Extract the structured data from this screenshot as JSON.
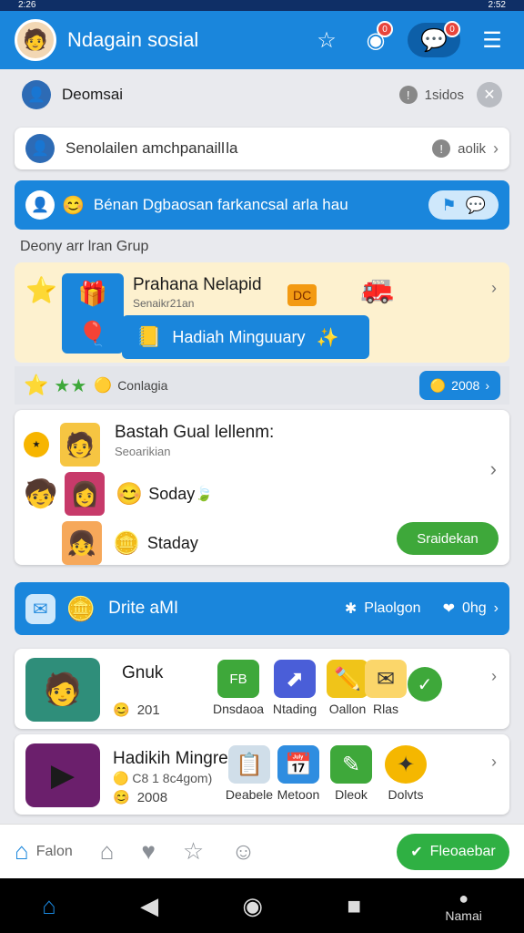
{
  "status": {
    "time": "2:26",
    "battery": "2:52"
  },
  "header": {
    "title": "Ndagain sosial",
    "badge_games": "0",
    "badge_chat": "0"
  },
  "notice": {
    "text": "Deomsai",
    "meta": "1sidos"
  },
  "search": {
    "text": "Senolailen amchpanaill la",
    "meta": "aolik"
  },
  "banner": {
    "text": "Bénan Dgbaosan farkancsal arla hau"
  },
  "section_label": "Deony arr lran Grup",
  "promo": {
    "title": "Prahana Nelapid",
    "sub": "Senaikr21an",
    "button": "Hadiah Minguuary",
    "deco1": "DC"
  },
  "subrow": {
    "text": "Conlagia",
    "count": "2008"
  },
  "group": {
    "title": "Bastah Gual lellenm:",
    "sub": "Seoarikian",
    "row2": "Soday",
    "row3": "Staday",
    "action": "Sraidekan"
  },
  "bluebar2": {
    "label": "Drite aMI",
    "link1": "Plaolgon",
    "link2": "0hg"
  },
  "list1": {
    "title": "Gnuk",
    "count": "201",
    "apps": [
      {
        "label": "Dnsdaoa",
        "icon": "FB"
      },
      {
        "label": "Ntading"
      },
      {
        "label": "Oallon"
      },
      {
        "label": "Rlas"
      }
    ]
  },
  "list2": {
    "title": "Hadikih Mingreuak",
    "sub": "C8 1 8c4gom)",
    "count": "2008",
    "apps": [
      {
        "label": "Deabele"
      },
      {
        "label": "Metoon"
      },
      {
        "label": "Dleok"
      },
      {
        "label": "Dolvts"
      }
    ]
  },
  "bottom": {
    "home": "Falon",
    "action": "Fleoaebar"
  },
  "sysnav": {
    "label": "Namai"
  },
  "colors": {
    "primary": "#1a86dc",
    "green": "#3ea83a"
  }
}
